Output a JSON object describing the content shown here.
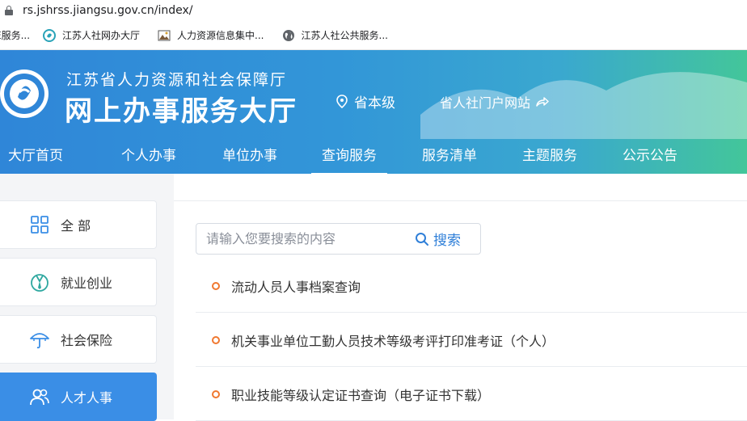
{
  "browser": {
    "url": "rs.jshrss.jiangsu.gov.cn/index/",
    "bookmarks": [
      {
        "label": "E服务...",
        "icon": "site-icon"
      },
      {
        "label": "江苏人社网办大厅",
        "icon": "swirl-logo-icon"
      },
      {
        "label": "人力资源信息集中...",
        "icon": "image-icon"
      },
      {
        "label": "江苏人社公共服务...",
        "icon": "globe-icon"
      }
    ]
  },
  "header": {
    "org_name": "江苏省人力资源和社会保障厅",
    "site_title": "网上办事服务大厅",
    "region": "省本级",
    "portal_link": "省人社门户网站"
  },
  "nav": {
    "items": [
      "大厅首页",
      "个人办事",
      "单位办事",
      "查询服务",
      "服务清单",
      "主题服务",
      "公示公告"
    ],
    "active": "查询服务"
  },
  "sidebar": {
    "items": [
      {
        "label": "全 部",
        "icon": "grid-icon"
      },
      {
        "label": "就业创业",
        "icon": "medal-icon"
      },
      {
        "label": "社会保险",
        "icon": "umbrella-icon"
      },
      {
        "label": "人才人事",
        "icon": "people-icon"
      }
    ],
    "active": "人才人事"
  },
  "search": {
    "placeholder": "请输入您要搜索的内容",
    "value": "",
    "button_label": "搜索"
  },
  "results": [
    "流动人员人事档案查询",
    "机关事业单位工勤人员技术等级考评打印准考证（个人）",
    "职业技能等级认定证书查询（电子证书下载）"
  ],
  "colors": {
    "accent": "#3a8ee6",
    "banner_start": "#2f86d8",
    "banner_end": "#43c69a",
    "bullet": "#f07830",
    "search_text": "#2f7fd8"
  }
}
